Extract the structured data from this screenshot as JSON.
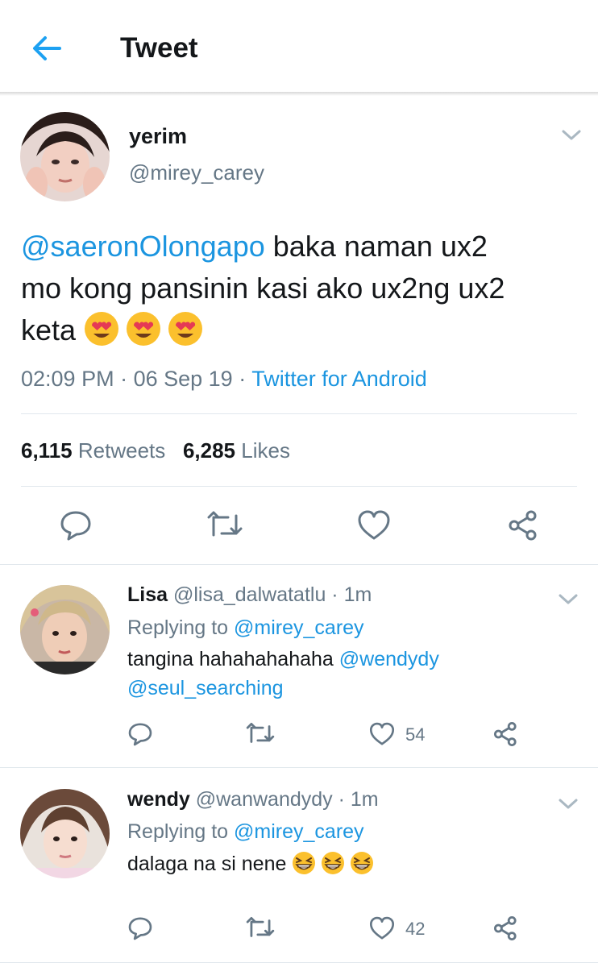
{
  "header": {
    "title": "Tweet",
    "back_icon": "arrow-left-icon"
  },
  "colors": {
    "accent": "#1da1f2",
    "link": "#1b95e0",
    "secondary_text": "#657786",
    "divider": "#e1e8ed"
  },
  "tweet": {
    "name": "yerim",
    "handle": "@mirey_carey",
    "mention": "@saeronOlongapo",
    "text_line1": " baka naman ux2",
    "text_line2": "mo kong pansinin kasi ako ux2ng ux2",
    "text_line3": "keta",
    "emoji": "smiling-face-with-heart-eyes",
    "time": "02:09 PM",
    "date": "06 Sep 19",
    "source": "Twitter for Android",
    "retweets_count": "6,115",
    "retweets_label": "Retweets",
    "likes_count": "6,285",
    "likes_label": "Likes"
  },
  "replies": [
    {
      "name": "Lisa",
      "handle": "@lisa_dalwatatlu",
      "time": "1m",
      "replying_prefix": "Replying to",
      "replying_to": "@mirey_carey",
      "text": "tangina hahahahahaha ",
      "mention1": "@wendydy",
      "mention2": "@seul_searching",
      "like_count": "54"
    },
    {
      "name": "wendy",
      "handle": "@wanwandydy",
      "time": "1m",
      "replying_prefix": "Replying to",
      "replying_to": "@mirey_carey",
      "text": "dalaga na si nene ",
      "emoji": "grinning-squinting-face",
      "like_count": "42"
    }
  ],
  "separator": " · "
}
